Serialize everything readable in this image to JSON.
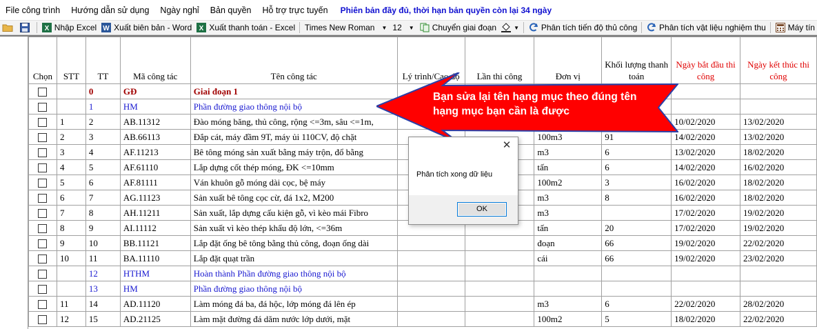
{
  "menu": {
    "items": [
      "File công trình",
      "Hướng dẫn sử dụng",
      "Ngày nghỉ",
      "Bản quyền",
      "Hỗ trợ trực tuyến"
    ],
    "license_text": "Phiên bản đầy đủ, thời hạn bản quyền còn lại 34 ngày"
  },
  "toolbar": {
    "import_excel": "Nhập Excel",
    "export_word": "Xuất biên bản - Word",
    "export_payment": "Xuất thanh toán - Excel",
    "font_name": "Times New Roman",
    "font_size": "12",
    "change_stage": "Chuyển giai đoạn",
    "analyze_progress": "Phân tích tiến độ thủ công",
    "analyze_material": "Phân tích vật liệu nghiệm thu",
    "machine": "Máy tín"
  },
  "table": {
    "headers": {
      "chon": "Chọn",
      "stt": "STT",
      "tt": "TT",
      "ma": "Mã công tác",
      "ten": "Tên công tác",
      "ly_trinh": "Lý trình/Cao độ",
      "lan": "Lần thi công",
      "don_vi": "Đơn vị",
      "khoi_luong": "Khối lượng thanh toán",
      "bat_dau": "Ngày bắt đầu thi công",
      "ket_thuc": "Ngày kết thúc thi công"
    },
    "rows": [
      {
        "type": "stage",
        "stt": "",
        "tt": "0",
        "ma": "GĐ",
        "ten": "Giai đoạn 1",
        "unit": "",
        "qty": "",
        "start": "",
        "end": ""
      },
      {
        "type": "section",
        "stt": "",
        "tt": "1",
        "ma": "HM",
        "ten": "Phần đường giao thông nội bộ",
        "unit": "",
        "qty": "",
        "start": "",
        "end": ""
      },
      {
        "type": "task",
        "stt": "1",
        "tt": "2",
        "ma": "AB.11312",
        "ten": "Đào móng băng, thủ công, rộng <=3m, sâu <=1m,",
        "unit": "",
        "qty": "",
        "start": "10/02/2020",
        "end": "13/02/2020"
      },
      {
        "type": "task",
        "stt": "2",
        "tt": "3",
        "ma": "AB.66113",
        "ten": "Đắp cát, máy đầm 9T, máy ủi 110CV, độ chặt",
        "unit": "100m3",
        "qty": "91",
        "start": "14/02/2020",
        "end": "13/02/2020"
      },
      {
        "type": "task",
        "stt": "3",
        "tt": "4",
        "ma": "AF.11213",
        "ten": "Bê tông móng sản xuất bằng máy trộn, đổ bằng",
        "unit": "m3",
        "qty": "6",
        "start": "13/02/2020",
        "end": "18/02/2020"
      },
      {
        "type": "task",
        "stt": "4",
        "tt": "5",
        "ma": "AF.61110",
        "ten": "Lắp dựng cốt thép móng, ĐK <=10mm",
        "unit": "tấn",
        "qty": "6",
        "start": "14/02/2020",
        "end": "16/02/2020"
      },
      {
        "type": "task",
        "stt": "5",
        "tt": "6",
        "ma": "AF.81111",
        "ten": "Ván khuôn gỗ móng dài cọc, bệ máy",
        "unit": "100m2",
        "qty": "3",
        "start": "16/02/2020",
        "end": "18/02/2020"
      },
      {
        "type": "task",
        "stt": "6",
        "tt": "7",
        "ma": "AG.11123",
        "ten": "Sản xuất bê tông cọc cừ, đá 1x2, M200",
        "unit": "m3",
        "qty": "8",
        "start": "16/02/2020",
        "end": "18/02/2020"
      },
      {
        "type": "task",
        "stt": "7",
        "tt": "8",
        "ma": "AH.11211",
        "ten": "Sản xuất, lắp dựng cấu kiện gỗ, vì kèo mái Fibro",
        "unit": "m3",
        "qty": "",
        "start": "17/02/2020",
        "end": "19/02/2020"
      },
      {
        "type": "task",
        "stt": "8",
        "tt": "9",
        "ma": "AI.11112",
        "ten": "Sản xuất vì kèo thép khẩu độ lớn, <=36m",
        "unit": "tấn",
        "qty": "20",
        "start": "17/02/2020",
        "end": "19/02/2020"
      },
      {
        "type": "task",
        "stt": "9",
        "tt": "10",
        "ma": "BB.11121",
        "ten": "Lắp đặt ống bê tông bằng thủ công, đoạn ống dài",
        "unit": "đoạn",
        "qty": "66",
        "start": "19/02/2020",
        "end": "22/02/2020"
      },
      {
        "type": "task",
        "stt": "10",
        "tt": "11",
        "ma": "BA.11110",
        "ten": "Lắp đặt quạt trần",
        "unit": "cái",
        "qty": "66",
        "start": "19/02/2020",
        "end": "23/02/2020"
      },
      {
        "type": "section",
        "stt": "",
        "tt": "12",
        "ma": "HTHM",
        "ten": "Hoàn thành Phần đường giao thông nội bộ",
        "unit": "",
        "qty": "",
        "start": "",
        "end": ""
      },
      {
        "type": "section",
        "stt": "",
        "tt": "13",
        "ma": "HM",
        "ten": "Phần đường giao thông nội bộ",
        "unit": "",
        "qty": "",
        "start": "",
        "end": ""
      },
      {
        "type": "task",
        "stt": "11",
        "tt": "14",
        "ma": "AD.11120",
        "ten": "Làm móng đá ba, đá hộc, lớp móng đá lên ép",
        "unit": "m3",
        "qty": "6",
        "start": "22/02/2020",
        "end": "28/02/2020"
      },
      {
        "type": "task",
        "stt": "12",
        "tt": "15",
        "ma": "AD.21125",
        "ten": "Làm mặt đường đá dăm nước lớp dưới, mặt",
        "unit": "100m2",
        "qty": "5",
        "start": "18/02/2020",
        "end": "22/02/2020"
      }
    ]
  },
  "callout": {
    "text": "Bạn sửa lại tên hạng mục theo đúng tên hạng mục bạn cần là được",
    "fill_color": "#ff0000",
    "outline_color": "#2a3fa8"
  },
  "dialog": {
    "message": "Phân tích xong dữ liệu",
    "ok_label": "OK"
  }
}
